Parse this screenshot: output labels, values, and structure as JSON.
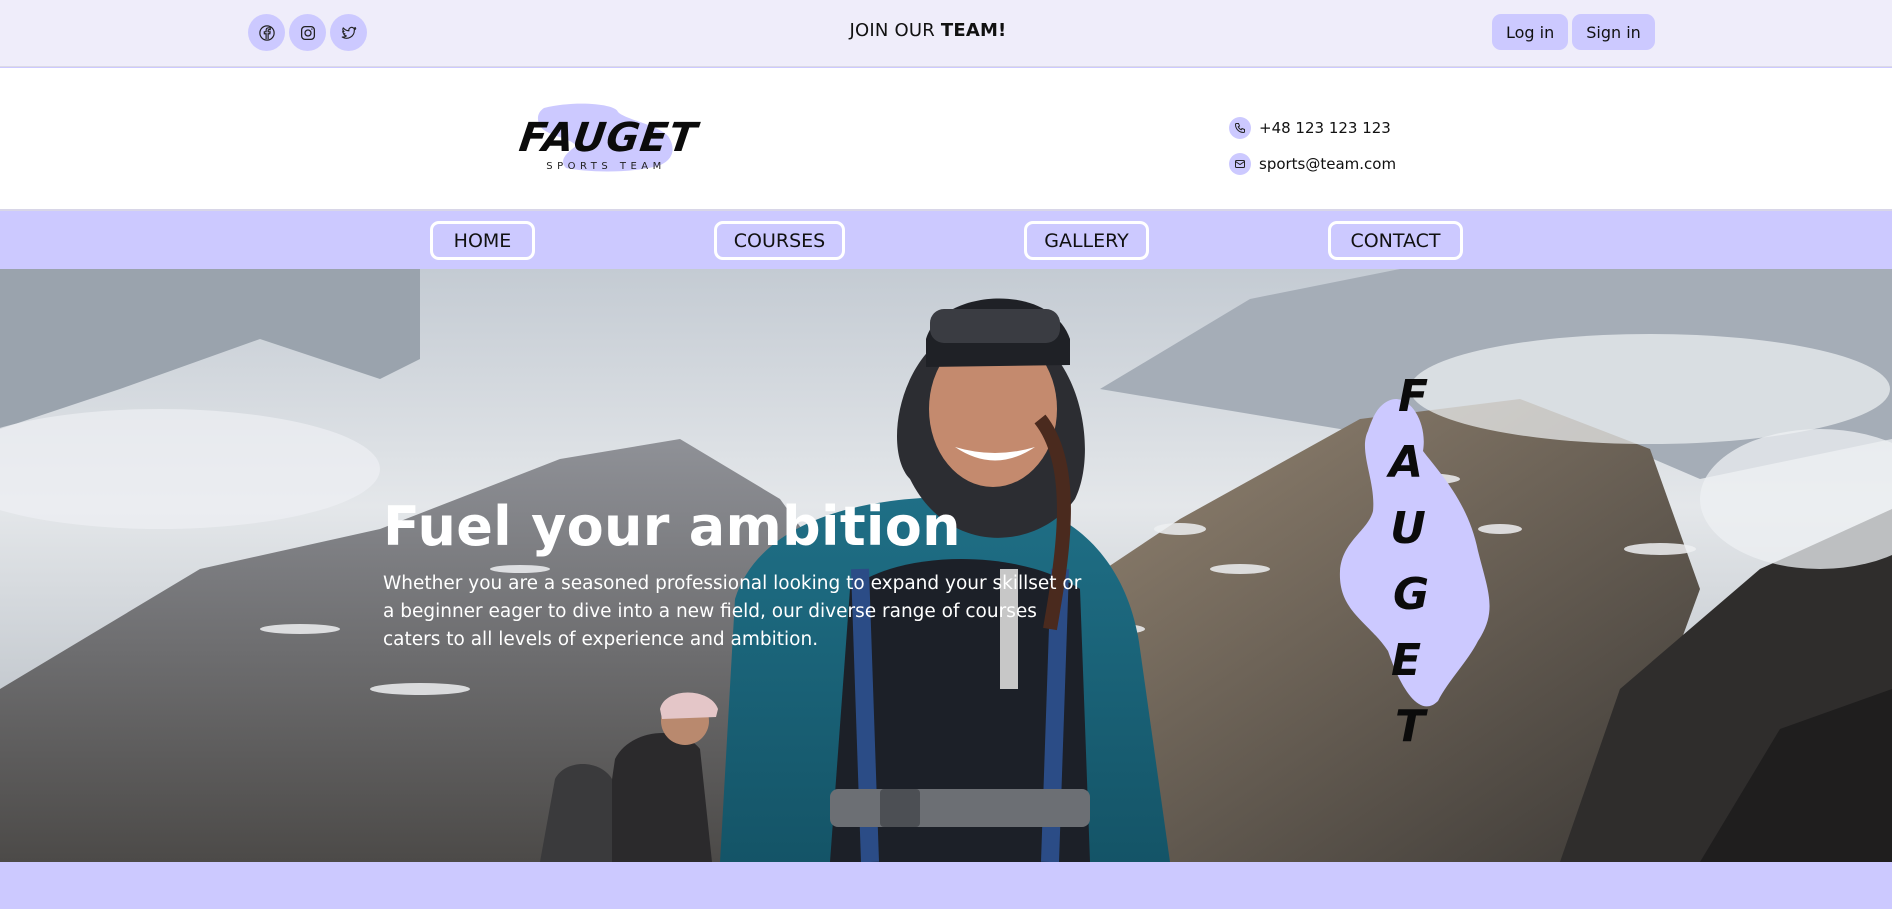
{
  "topbar": {
    "social": [
      {
        "icon": "facebook-icon"
      },
      {
        "icon": "instagram-icon"
      },
      {
        "icon": "twitter-icon"
      }
    ],
    "join_prefix": "JOIN OUR",
    "join_emphasis": "TEAM!",
    "login_label": "Log in",
    "signin_label": "Sign in"
  },
  "header": {
    "logo_text": "FAUGET",
    "logo_subtext": "SPORTS TEAM",
    "phone": "+48 123 123 123",
    "email": "sports@team.com"
  },
  "nav": {
    "items": [
      {
        "label": "HOME"
      },
      {
        "label": "COURSES"
      },
      {
        "label": "GALLERY"
      },
      {
        "label": "CONTACT"
      }
    ]
  },
  "hero": {
    "title": "Fuel your ambition",
    "text": "Whether you are a seasoned professional looking to expand your skillset or a beginner eager to dive into a new field, our diverse range of courses caters to all levels of experience and ambition.",
    "vertical_logo_letters": [
      "F",
      "A",
      "U",
      "G",
      "E",
      "T"
    ]
  },
  "colors": {
    "accent": "#ccc9ff",
    "topbar_bg": "#efedfa",
    "header_bg": "#ffffff",
    "text": "#111111"
  }
}
